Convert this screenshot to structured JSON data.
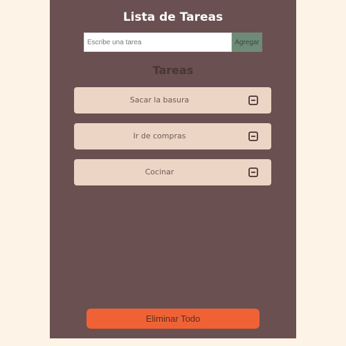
{
  "app": {
    "title": "Lista de Tareas"
  },
  "form": {
    "input_placeholder": "Escribe una tarea",
    "input_value": "",
    "add_label": "Agregar"
  },
  "tasks": {
    "heading": "Tareas",
    "items": [
      {
        "text": "Sacar la basura",
        "icon": "minus-square-icon"
      },
      {
        "text": "Ir de compras",
        "icon": "minus-square-icon"
      },
      {
        "text": "Cocinar",
        "icon": "minus-square-icon"
      }
    ]
  },
  "footer": {
    "clear_all_label": "Eliminar Todo"
  },
  "colors": {
    "page_background": "#fdf3e6",
    "panel_background": "#6a5050",
    "task_background": "#ecd5c4",
    "add_button": "#6e8b77",
    "clear_button": "#f06236"
  }
}
